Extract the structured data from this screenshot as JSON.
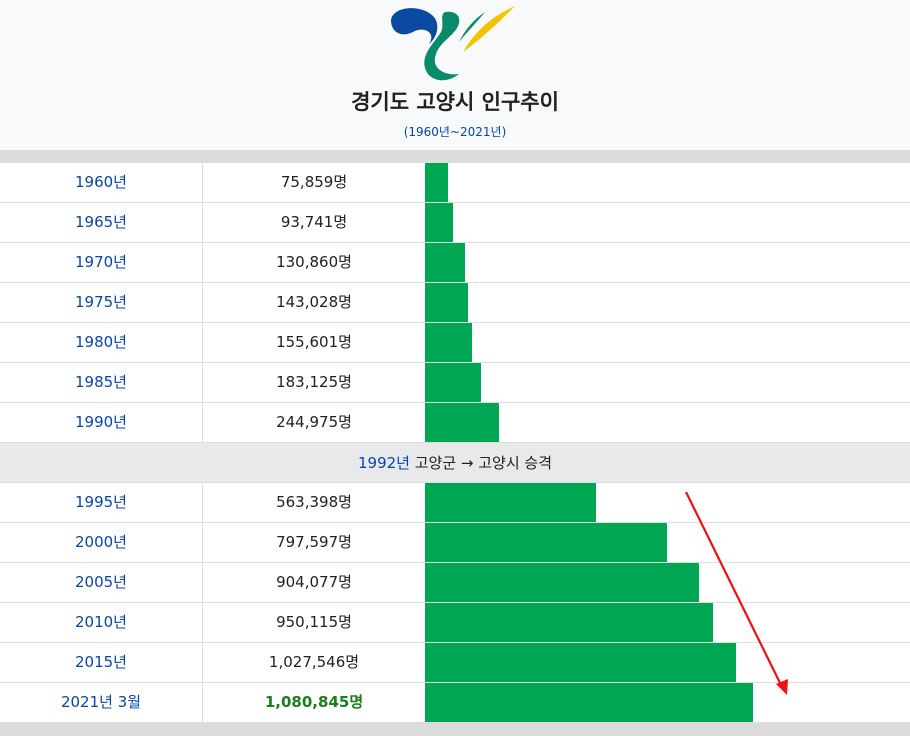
{
  "header": {
    "title": "경기도 고양시 인구추이",
    "subtitle": "(1960년~2021년)",
    "logo_colors": {
      "blue": "#0b4aa2",
      "teal": "#0a8a6a",
      "yellow": "#f5c400"
    }
  },
  "chart_data": {
    "type": "bar",
    "orientation": "horizontal",
    "categories": [
      "1960년",
      "1965년",
      "1970년",
      "1975년",
      "1980년",
      "1985년",
      "1990년",
      "1995년",
      "2000년",
      "2005년",
      "2010년",
      "2015년",
      "2021년 3월"
    ],
    "values": [
      75859,
      93741,
      130860,
      143028,
      155601,
      183125,
      244975,
      563398,
      797597,
      904077,
      950115,
      1027546,
      1080845
    ],
    "value_labels": [
      "75,859명",
      "93,741명",
      "130,860명",
      "143,028명",
      "155,601명",
      "183,125명",
      "244,975명",
      "563,398명",
      "797,597명",
      "904,077명",
      "950,115명",
      "1,027,546명",
      "1,080,845명"
    ],
    "bar_color": "#00a651",
    "highlight_color": "#1a7f1a",
    "xlim": [
      0,
      1600000
    ]
  },
  "event": {
    "year": "1992년",
    "text": " 고양군 → 고양시 승격"
  },
  "annotation": {
    "arrow_color": "#ee1111"
  }
}
